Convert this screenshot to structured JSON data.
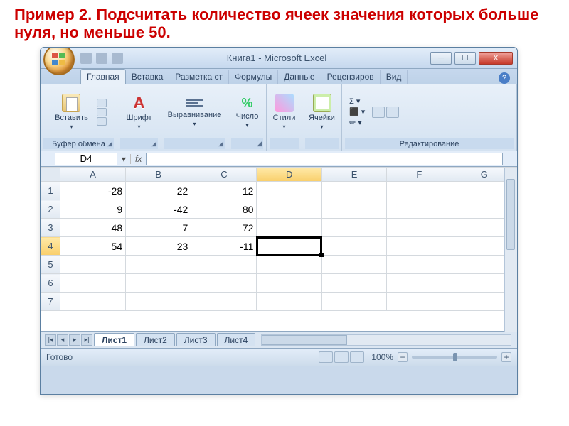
{
  "task": "Пример 2. Подсчитать количество ячеек значения которых больше нуля, но меньше 50.",
  "window": {
    "title": "Книга1 - Microsoft Excel"
  },
  "tabs": [
    "Главная",
    "Вставка",
    "Разметка ст",
    "Формулы",
    "Данные",
    "Рецензиров",
    "Вид"
  ],
  "active_tab": 0,
  "ribbon_groups": {
    "clipboard": {
      "button": "Вставить",
      "label": "Буфер обмена"
    },
    "font": {
      "label": "Шрифт",
      "A": "A"
    },
    "align": {
      "label": "Выравнивание"
    },
    "number": {
      "label": "Число",
      "sym": "%"
    },
    "styles": {
      "label": "Стили"
    },
    "cells": {
      "label": "Ячейки"
    },
    "editing": {
      "label": "Редактирование",
      "sigma": "Σ"
    }
  },
  "namebox": "D4",
  "formula": "",
  "columns": [
    "A",
    "B",
    "C",
    "D",
    "E",
    "F",
    "G"
  ],
  "selected_col": "D",
  "selected_row": 4,
  "rows": [
    {
      "n": 1,
      "cells": [
        "-28",
        "22",
        "12",
        "",
        "",
        "",
        ""
      ]
    },
    {
      "n": 2,
      "cells": [
        "9",
        "-42",
        "80",
        "",
        "",
        "",
        ""
      ]
    },
    {
      "n": 3,
      "cells": [
        "48",
        "7",
        "72",
        "",
        "",
        "",
        ""
      ]
    },
    {
      "n": 4,
      "cells": [
        "54",
        "23",
        "-11",
        "",
        "",
        "",
        ""
      ]
    },
    {
      "n": 5,
      "cells": [
        "",
        "",
        "",
        "",
        "",
        "",
        ""
      ]
    },
    {
      "n": 6,
      "cells": [
        "",
        "",
        "",
        "",
        "",
        "",
        ""
      ]
    },
    {
      "n": 7,
      "cells": [
        "",
        "",
        "",
        "",
        "",
        "",
        ""
      ]
    }
  ],
  "sheets": [
    "Лист1",
    "Лист2",
    "Лист3",
    "Лист4"
  ],
  "active_sheet": 0,
  "status": {
    "ready": "Готово",
    "zoom": "100%",
    "nav": [
      "|◂",
      "◂",
      "▸",
      "▸|"
    ]
  },
  "icons": {
    "help": "?",
    "fx": "fx",
    "dlg": "◢",
    "min": "─",
    "max": "☐",
    "close": "X",
    "dd": "▾",
    "minus": "−",
    "plus": "+"
  }
}
